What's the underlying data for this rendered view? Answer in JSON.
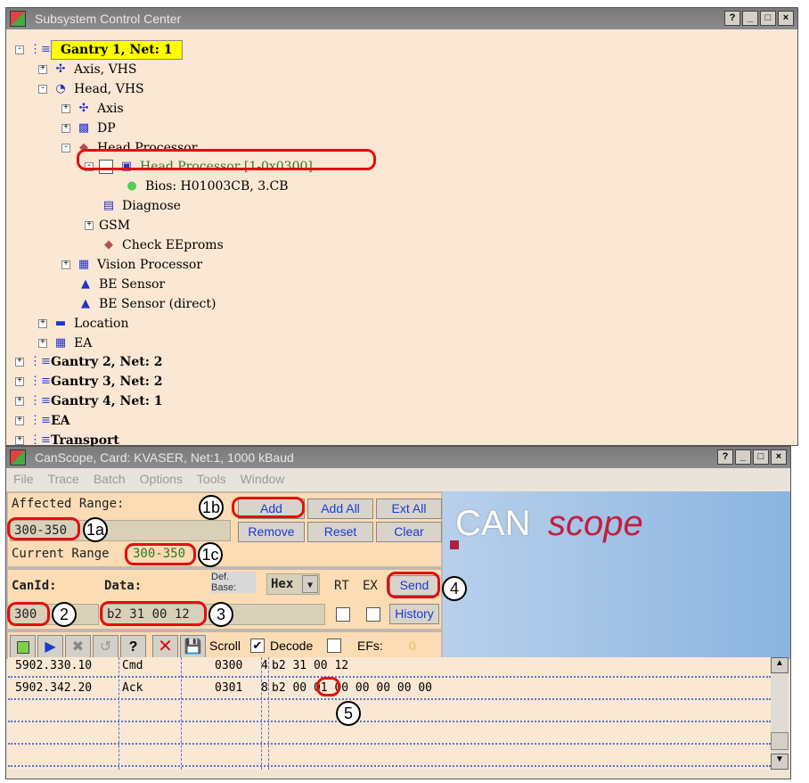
{
  "tree_window": {
    "title": "Subsystem Control Center",
    "buttons": [
      "?",
      "_",
      "□",
      "×"
    ],
    "rows": [
      {
        "label": "Gantry 1, Net: 1",
        "expander": "-",
        "icon": "network-icon"
      },
      {
        "label": "Axis, VHS",
        "expander": "+",
        "icon": "axis-icon"
      },
      {
        "label": "Head, VHS",
        "expander": "-",
        "icon": "head-icon"
      },
      {
        "label": "Axis",
        "expander": "+",
        "icon": "axis-icon"
      },
      {
        "label": "DP",
        "expander": "+",
        "icon": "dp-icon"
      },
      {
        "label": "Head Processor",
        "expander": "-",
        "icon": "chip-icon"
      },
      {
        "label": "Head Processor [1-0x0300]",
        "expander": "-",
        "icon": "device-icon"
      },
      {
        "label": "Bios: H01003CB, 3.CB",
        "expander": "",
        "icon": "status-dot-icon"
      },
      {
        "label": "Diagnose",
        "expander": "",
        "icon": "diagnose-icon"
      },
      {
        "label": "GSM",
        "expander": "+",
        "icon": ""
      },
      {
        "label": "Check EEproms",
        "expander": "",
        "icon": "chip-icon"
      },
      {
        "label": "Vision Processor",
        "expander": "+",
        "icon": "camera-icon"
      },
      {
        "label": "BE Sensor",
        "expander": "",
        "icon": "sensor-icon"
      },
      {
        "label": "BE Sensor (direct)",
        "expander": "",
        "icon": "sensor-icon"
      },
      {
        "label": "Location",
        "expander": "+",
        "icon": "location-icon"
      },
      {
        "label": "EA",
        "expander": "+",
        "icon": "grid-icon"
      },
      {
        "label": "Gantry 2, Net: 2",
        "expander": "+",
        "icon": "network-icon"
      },
      {
        "label": "Gantry 3, Net: 2",
        "expander": "+",
        "icon": "network-icon"
      },
      {
        "label": "Gantry 4, Net: 1",
        "expander": "+",
        "icon": "network-icon"
      },
      {
        "label": "EA",
        "expander": "+",
        "icon": "network-icon"
      },
      {
        "label": "Transport",
        "expander": "+",
        "icon": "network-icon"
      }
    ]
  },
  "can_window": {
    "title": "CanScope, Card: KVASER, Net:1, 1000 kBaud",
    "buttons": [
      "?",
      "_",
      "□",
      "×"
    ],
    "menu": [
      "File",
      "Trace",
      "Batch",
      "Options",
      "Tools",
      "Window"
    ],
    "affected_range_label": "Affected Range:",
    "affected_range_value": "300-350",
    "current_range_label": "Current Range",
    "current_range_value": "300-350",
    "range_buttons": [
      "Add",
      "Add All",
      "Ext All",
      "Remove",
      "Reset",
      "Clear"
    ],
    "canid_label": "CanId:",
    "canid_value": "300",
    "data_label": "Data:",
    "data_value": "b2 31 00 12",
    "def_base_label": "Def. Base:",
    "def_base_value": "Hex",
    "rt_label": "RT",
    "ex_label": "EX",
    "send_label": "Send",
    "history_label": "History",
    "scroll_label": "Scroll",
    "scroll_checked": "✔",
    "decode_label": "Decode",
    "efs_label": "EFs:",
    "efs_value": "0",
    "logo": {
      "can": "CAN",
      "scope": "scope"
    },
    "log_rows": [
      {
        "time": "5902.330.10",
        "type": "Cmd",
        "id": "0300",
        "len": "4",
        "data": "b2 31 00 12"
      },
      {
        "time": "5902.342.20",
        "type": "Ack",
        "id": "0301",
        "len": "8",
        "data": "b2 00 01 00 00 00 00 00"
      }
    ]
  },
  "annotations": [
    "1a",
    "1b",
    "1c",
    "2",
    "3",
    "4",
    "5"
  ]
}
